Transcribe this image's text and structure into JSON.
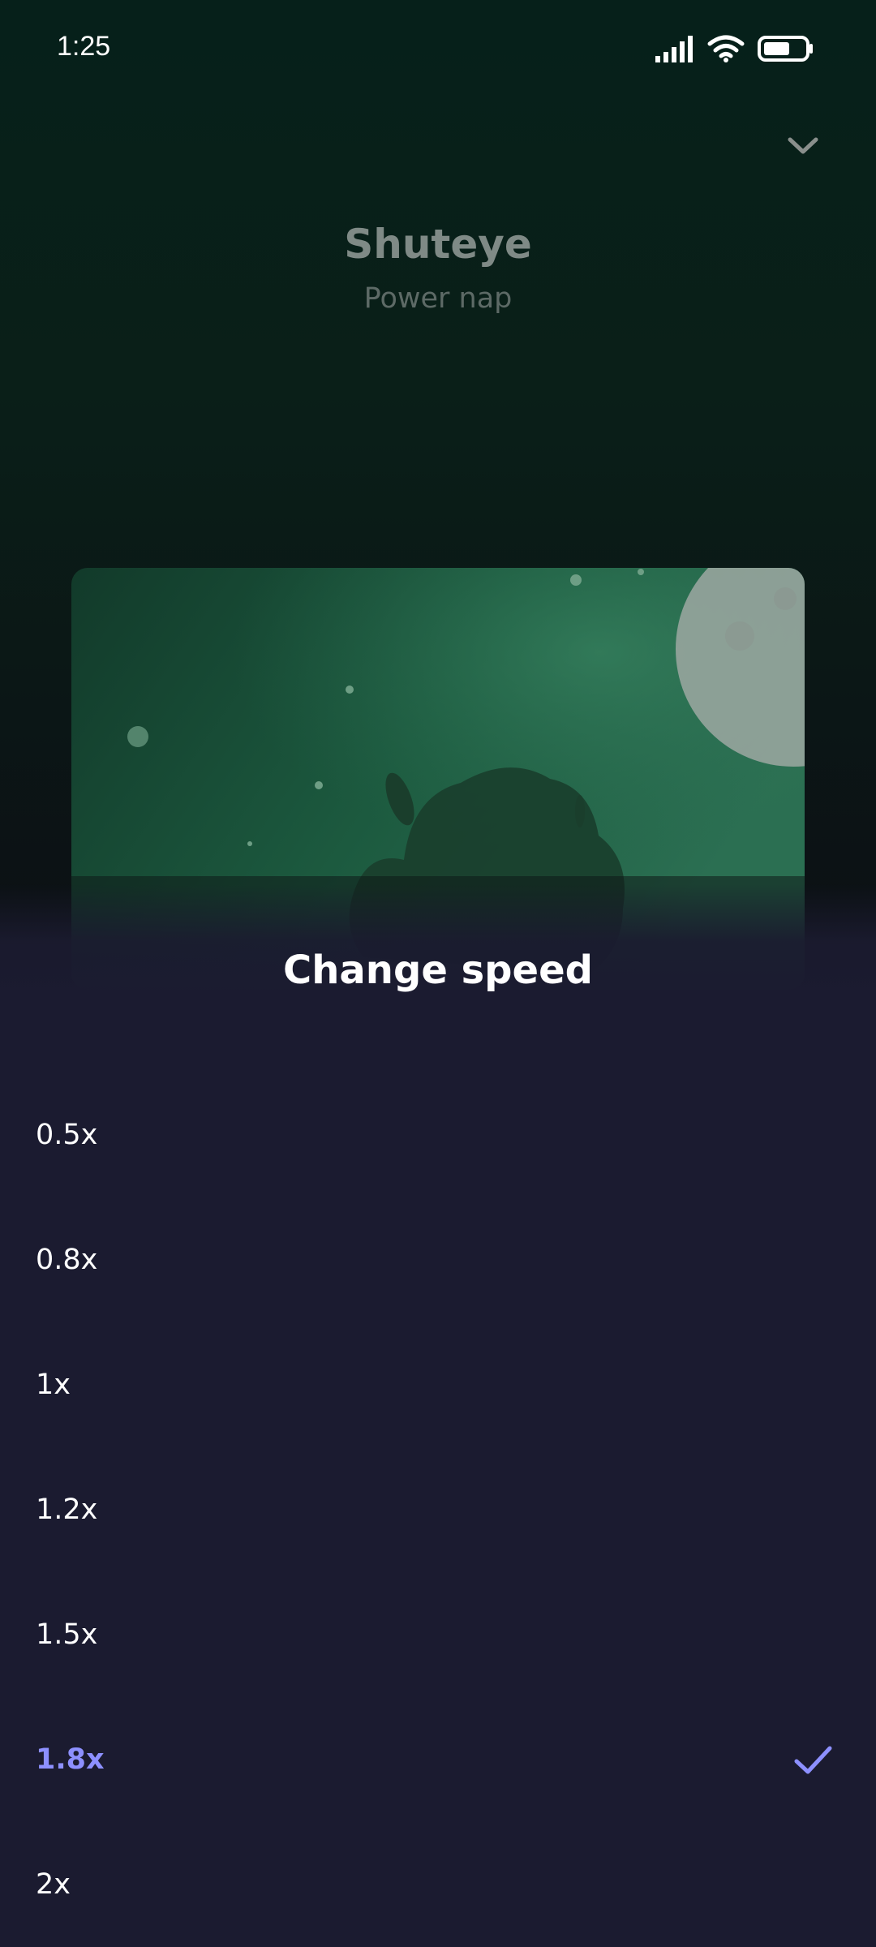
{
  "status_bar": {
    "time": "1:25",
    "battery_level": 0.65
  },
  "header": {
    "title": "Shuteye",
    "subtitle": "Power nap",
    "collapse_icon": "chevron-down-icon"
  },
  "sheet": {
    "title": "Change speed",
    "options": [
      {
        "label": "0.5x",
        "selected": false
      },
      {
        "label": "0.8x",
        "selected": false
      },
      {
        "label": "1x",
        "selected": false
      },
      {
        "label": "1.2x",
        "selected": false
      },
      {
        "label": "1.5x",
        "selected": false
      },
      {
        "label": "1.8x",
        "selected": true
      },
      {
        "label": "2x",
        "selected": false
      }
    ],
    "selected_icon": "check-icon"
  },
  "colors": {
    "accent": "#8d90ff",
    "sheet_bg": "#1b1b30"
  }
}
